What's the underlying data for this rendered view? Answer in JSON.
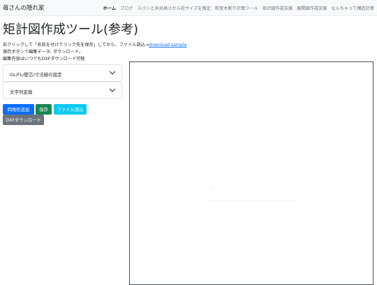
{
  "navbar": {
    "brand": "苺さんの隠れ家",
    "links": [
      "ホーム",
      "ブログ",
      "スパンと天井高さから柱サイズを推定",
      "和室木割り計算ツール",
      "矩計図作成支援",
      "展開図作成支援",
      "なんちゃって構造計算"
    ]
  },
  "page": {
    "title": "矩計図作成ツール(参考)",
    "desc_line1_prefix": "右クリックして「名前を付けてリンク先を保存」してから、ファイル読込→",
    "download_link": "download sample",
    "desc_line2": "保存ボタンで編集データ, ダウンロード。",
    "desc_line3": "編集内容はいつでもDXFダウンロード可能"
  },
  "accordion": {
    "item1": "GL/FL/壁芯/寸法線の設定",
    "item2": "文字列変換"
  },
  "buttons": {
    "add_rect": "四角形追加",
    "save": "保存",
    "file_load": "ファイル読込",
    "dxf_download": "DXFダウンロード"
  },
  "colors": {
    "primary": "#0d6efd",
    "success": "#198754",
    "info": "#0dcaf0",
    "secondary": "#6c757d"
  }
}
